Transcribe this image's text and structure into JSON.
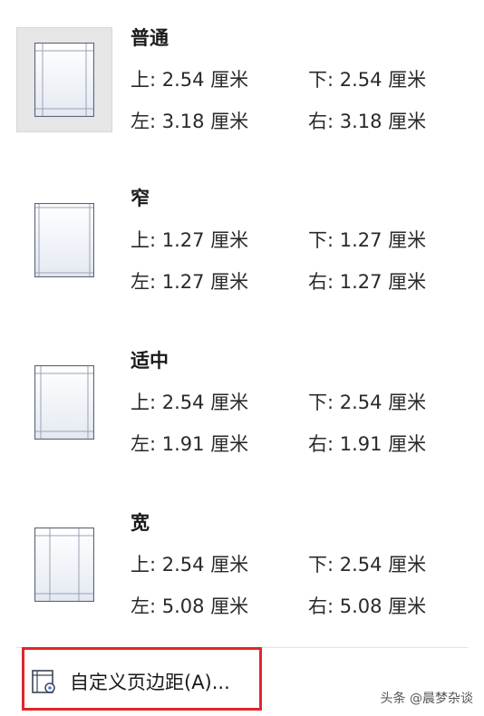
{
  "presets": [
    {
      "name": "普通",
      "top": "上: 2.54 厘米",
      "bottom": "下: 2.54 厘米",
      "left": "左: 3.18 厘米",
      "right": "右: 3.18 厘米"
    },
    {
      "name": "窄",
      "top": "上: 1.27 厘米",
      "bottom": "下: 1.27 厘米",
      "left": "左: 1.27 厘米",
      "right": "右: 1.27 厘米"
    },
    {
      "name": "适中",
      "top": "上: 2.54 厘米",
      "bottom": "下: 2.54 厘米",
      "left": "左: 1.91 厘米",
      "right": "右: 1.91 厘米"
    },
    {
      "name": "宽",
      "top": "上: 2.54 厘米",
      "bottom": "下: 2.54 厘米",
      "left": "左: 5.08 厘米",
      "right": "右: 5.08 厘米"
    }
  ],
  "custom": {
    "label": "自定义页边距(A)...",
    "icon": "page-setup-icon"
  },
  "watermark": "头条 @晨梦杂谈",
  "colors": {
    "selected_bg": "#e6e6e6",
    "highlight_border": "#e0262b",
    "page_border": "#5b6478"
  }
}
